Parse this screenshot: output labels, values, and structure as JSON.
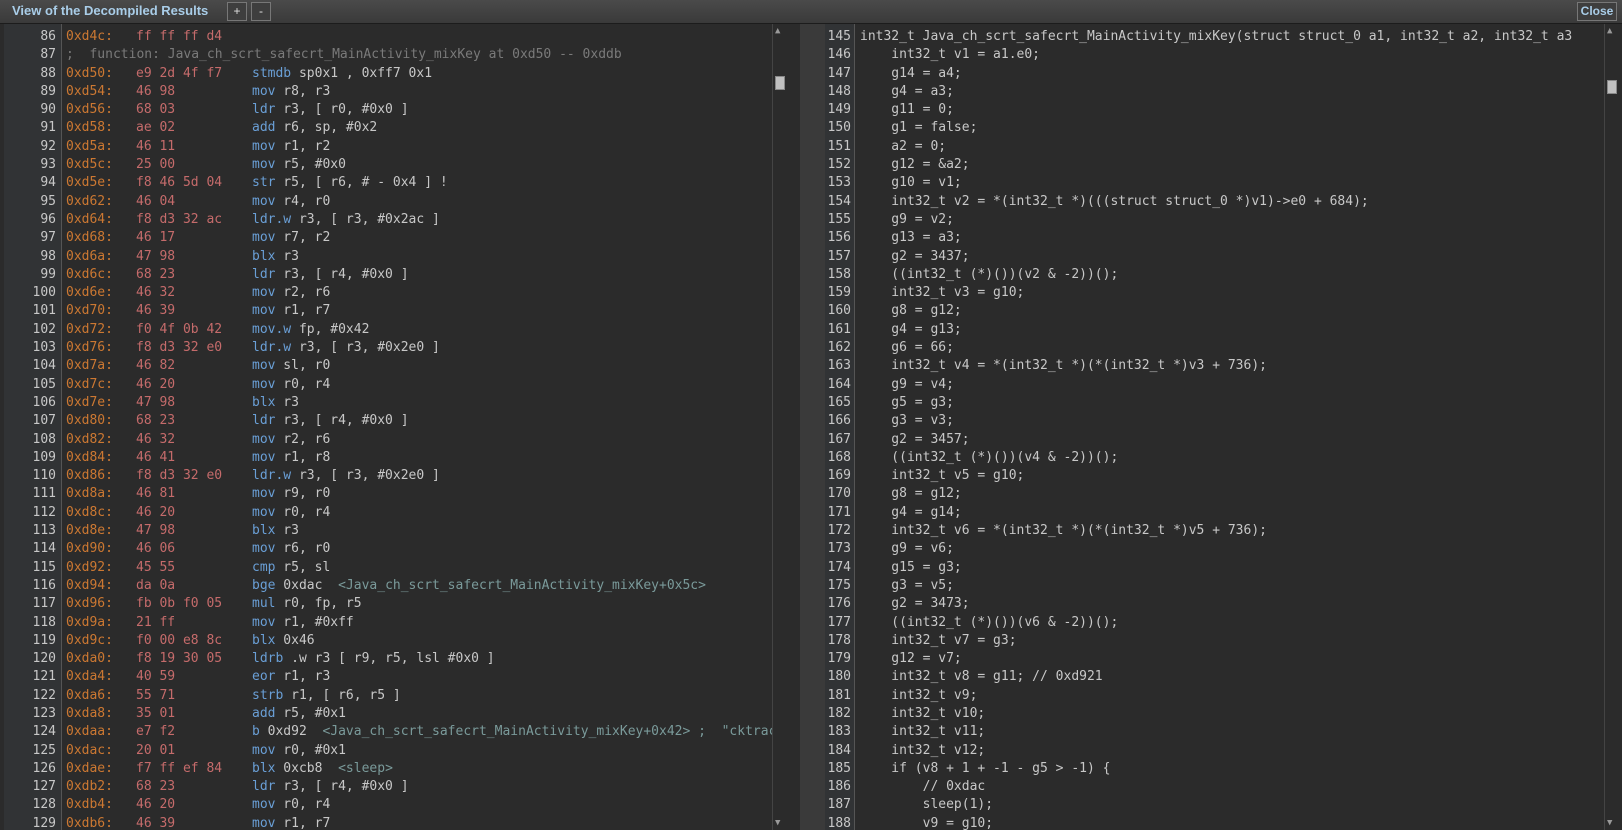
{
  "window": {
    "title": "View of the Decompiled Results",
    "zoom_in_label": "+",
    "zoom_out_label": "-",
    "close_label": "Close"
  },
  "asm": {
    "lines": [
      {
        "n": "86",
        "addr": "0xd4c:",
        "hex": "ff ff ff d4",
        "ins": ""
      },
      {
        "n": "87",
        "addr": "",
        "hex": "",
        "ins": "",
        "comment": ";  function: Java_ch_scrt_safecrt_MainActivity_mixKey at 0xd50 -- 0xddb"
      },
      {
        "n": "88",
        "addr": "0xd50:",
        "hex": "e9 2d 4f f7",
        "mn": "stmdb",
        "ops": "sp0x1 , 0xff7 0x1"
      },
      {
        "n": "89",
        "addr": "0xd54:",
        "hex": "46 98",
        "mn": "mov",
        "ops": "r8, r3"
      },
      {
        "n": "90",
        "addr": "0xd56:",
        "hex": "68 03",
        "mn": "ldr",
        "ops": "r3, [ r0, #0x0 ]"
      },
      {
        "n": "91",
        "addr": "0xd58:",
        "hex": "ae 02",
        "mn": "add",
        "ops": "r6, sp, #0x2"
      },
      {
        "n": "92",
        "addr": "0xd5a:",
        "hex": "46 11",
        "mn": "mov",
        "ops": "r1, r2"
      },
      {
        "n": "93",
        "addr": "0xd5c:",
        "hex": "25 00",
        "mn": "mov",
        "ops": "r5, #0x0"
      },
      {
        "n": "94",
        "addr": "0xd5e:",
        "hex": "f8 46 5d 04",
        "mn": "str",
        "ops": "r5, [ r6, # - 0x4 ] !"
      },
      {
        "n": "95",
        "addr": "0xd62:",
        "hex": "46 04",
        "mn": "mov",
        "ops": "r4, r0"
      },
      {
        "n": "96",
        "addr": "0xd64:",
        "hex": "f8 d3 32 ac",
        "mn": "ldr.w",
        "ops": "r3, [ r3, #0x2ac ]"
      },
      {
        "n": "97",
        "addr": "0xd68:",
        "hex": "46 17",
        "mn": "mov",
        "ops": "r7, r2"
      },
      {
        "n": "98",
        "addr": "0xd6a:",
        "hex": "47 98",
        "mn": "blx",
        "ops": "r3"
      },
      {
        "n": "99",
        "addr": "0xd6c:",
        "hex": "68 23",
        "mn": "ldr",
        "ops": "r3, [ r4, #0x0 ]"
      },
      {
        "n": "100",
        "addr": "0xd6e:",
        "hex": "46 32",
        "mn": "mov",
        "ops": "r2, r6"
      },
      {
        "n": "101",
        "addr": "0xd70:",
        "hex": "46 39",
        "mn": "mov",
        "ops": "r1, r7"
      },
      {
        "n": "102",
        "addr": "0xd72:",
        "hex": "f0 4f 0b 42",
        "mn": "mov.w",
        "ops": "fp, #0x42"
      },
      {
        "n": "103",
        "addr": "0xd76:",
        "hex": "f8 d3 32 e0",
        "mn": "ldr.w",
        "ops": "r3, [ r3, #0x2e0 ]"
      },
      {
        "n": "104",
        "addr": "0xd7a:",
        "hex": "46 82",
        "mn": "mov",
        "ops": "sl, r0"
      },
      {
        "n": "105",
        "addr": "0xd7c:",
        "hex": "46 20",
        "mn": "mov",
        "ops": "r0, r4"
      },
      {
        "n": "106",
        "addr": "0xd7e:",
        "hex": "47 98",
        "mn": "blx",
        "ops": "r3"
      },
      {
        "n": "107",
        "addr": "0xd80:",
        "hex": "68 23",
        "mn": "ldr",
        "ops": "r3, [ r4, #0x0 ]"
      },
      {
        "n": "108",
        "addr": "0xd82:",
        "hex": "46 32",
        "mn": "mov",
        "ops": "r2, r6"
      },
      {
        "n": "109",
        "addr": "0xd84:",
        "hex": "46 41",
        "mn": "mov",
        "ops": "r1, r8"
      },
      {
        "n": "110",
        "addr": "0xd86:",
        "hex": "f8 d3 32 e0",
        "mn": "ldr.w",
        "ops": "r3, [ r3, #0x2e0 ]"
      },
      {
        "n": "111",
        "addr": "0xd8a:",
        "hex": "46 81",
        "mn": "mov",
        "ops": "r9, r0"
      },
      {
        "n": "112",
        "addr": "0xd8c:",
        "hex": "46 20",
        "mn": "mov",
        "ops": "r0, r4"
      },
      {
        "n": "113",
        "addr": "0xd8e:",
        "hex": "47 98",
        "mn": "blx",
        "ops": "r3"
      },
      {
        "n": "114",
        "addr": "0xd90:",
        "hex": "46 06",
        "mn": "mov",
        "ops": "r6, r0"
      },
      {
        "n": "115",
        "addr": "0xd92:",
        "hex": "45 55",
        "mn": "cmp",
        "ops": "r5, sl"
      },
      {
        "n": "116",
        "addr": "0xd94:",
        "hex": "da 0a",
        "mn": "bge",
        "ops": "0xdac",
        "sym": "<Java_ch_scrt_safecrt_MainActivity_mixKey+0x5c>"
      },
      {
        "n": "117",
        "addr": "0xd96:",
        "hex": "fb 0b f0 05",
        "mn": "mul",
        "ops": "r0, fp, r5"
      },
      {
        "n": "118",
        "addr": "0xd9a:",
        "hex": "21 ff",
        "mn": "mov",
        "ops": "r1, #0xff"
      },
      {
        "n": "119",
        "addr": "0xd9c:",
        "hex": "f0 00 e8 8c",
        "mn": "blx",
        "ops": "0x46"
      },
      {
        "n": "120",
        "addr": "0xda0:",
        "hex": "f8 19 30 05",
        "mn": "ldrb",
        "ops": ".w r3 [ r9, r5, lsl #0x0 ]"
      },
      {
        "n": "121",
        "addr": "0xda4:",
        "hex": "40 59",
        "mn": "eor",
        "ops": "r1, r3"
      },
      {
        "n": "122",
        "addr": "0xda6:",
        "hex": "55 71",
        "mn": "strb",
        "ops": "r1, [ r6, r5 ]"
      },
      {
        "n": "123",
        "addr": "0xda8:",
        "hex": "35 01",
        "mn": "add",
        "ops": "r5, #0x1"
      },
      {
        "n": "124",
        "addr": "0xdaa:",
        "hex": "e7 f2",
        "mn": "b",
        "ops": "0xd92",
        "sym": "<Java_ch_scrt_safecrt_MainActivity_mixKey+0x42> ;  \"cktrac"
      },
      {
        "n": "125",
        "addr": "0xdac:",
        "hex": "20 01",
        "mn": "mov",
        "ops": "r0, #0x1"
      },
      {
        "n": "126",
        "addr": "0xdae:",
        "hex": "f7 ff ef 84",
        "mn": "blx",
        "ops": "0xcb8",
        "sym": "<sleep>"
      },
      {
        "n": "127",
        "addr": "0xdb2:",
        "hex": "68 23",
        "mn": "ldr",
        "ops": "r3, [ r4, #0x0 ]"
      },
      {
        "n": "128",
        "addr": "0xdb4:",
        "hex": "46 20",
        "mn": "mov",
        "ops": "r0, r4"
      },
      {
        "n": "129",
        "addr": "0xdb6:",
        "hex": "46 39",
        "mn": "mov",
        "ops": "r1, r7"
      }
    ]
  },
  "decompiled": {
    "lines": [
      {
        "n": "145",
        "text": "int32_t Java_ch_scrt_safecrt_MainActivity_mixKey(struct struct_0 a1, int32_t a2, int32_t a3"
      },
      {
        "n": "146",
        "text": "    int32_t v1 = a1.e0;"
      },
      {
        "n": "147",
        "text": "    g14 = a4;"
      },
      {
        "n": "148",
        "text": "    g4 = a3;"
      },
      {
        "n": "149",
        "text": "    g11 = 0;"
      },
      {
        "n": "150",
        "text": "    g1 = false;"
      },
      {
        "n": "151",
        "text": "    a2 = 0;"
      },
      {
        "n": "152",
        "text": "    g12 = &a2;"
      },
      {
        "n": "153",
        "text": "    g10 = v1;"
      },
      {
        "n": "154",
        "text": "    int32_t v2 = *(int32_t *)(((struct struct_0 *)v1)->e0 + 684);"
      },
      {
        "n": "155",
        "text": "    g9 = v2;"
      },
      {
        "n": "156",
        "text": "    g13 = a3;"
      },
      {
        "n": "157",
        "text": "    g2 = 3437;"
      },
      {
        "n": "158",
        "text": "    ((int32_t (*)())(v2 & -2))();"
      },
      {
        "n": "159",
        "text": "    int32_t v3 = g10;"
      },
      {
        "n": "160",
        "text": "    g8 = g12;"
      },
      {
        "n": "161",
        "text": "    g4 = g13;"
      },
      {
        "n": "162",
        "text": "    g6 = 66;"
      },
      {
        "n": "163",
        "text": "    int32_t v4 = *(int32_t *)(*(int32_t *)v3 + 736);"
      },
      {
        "n": "164",
        "text": "    g9 = v4;"
      },
      {
        "n": "165",
        "text": "    g5 = g3;"
      },
      {
        "n": "166",
        "text": "    g3 = v3;"
      },
      {
        "n": "167",
        "text": "    g2 = 3457;"
      },
      {
        "n": "168",
        "text": "    ((int32_t (*)())(v4 & -2))();"
      },
      {
        "n": "169",
        "text": "    int32_t v5 = g10;"
      },
      {
        "n": "170",
        "text": "    g8 = g12;"
      },
      {
        "n": "171",
        "text": "    g4 = g14;"
      },
      {
        "n": "172",
        "text": "    int32_t v6 = *(int32_t *)(*(int32_t *)v5 + 736);"
      },
      {
        "n": "173",
        "text": "    g9 = v6;"
      },
      {
        "n": "174",
        "text": "    g15 = g3;"
      },
      {
        "n": "175",
        "text": "    g3 = v5;"
      },
      {
        "n": "176",
        "text": "    g2 = 3473;"
      },
      {
        "n": "177",
        "text": "    ((int32_t (*)())(v6 & -2))();"
      },
      {
        "n": "178",
        "text": "    int32_t v7 = g3;"
      },
      {
        "n": "179",
        "text": "    g12 = v7;"
      },
      {
        "n": "180",
        "text": "    int32_t v8 = g11; // 0xd921"
      },
      {
        "n": "181",
        "text": "    int32_t v9;"
      },
      {
        "n": "182",
        "text": "    int32_t v10;"
      },
      {
        "n": "183",
        "text": "    int32_t v11;"
      },
      {
        "n": "184",
        "text": "    int32_t v12;"
      },
      {
        "n": "185",
        "text": "    if (v8 + 1 + -1 - g5 > -1) {"
      },
      {
        "n": "186",
        "text": "        // 0xdac"
      },
      {
        "n": "187",
        "text": "        sleep(1);"
      },
      {
        "n": "188",
        "text": "        v9 = g10;"
      }
    ]
  }
}
